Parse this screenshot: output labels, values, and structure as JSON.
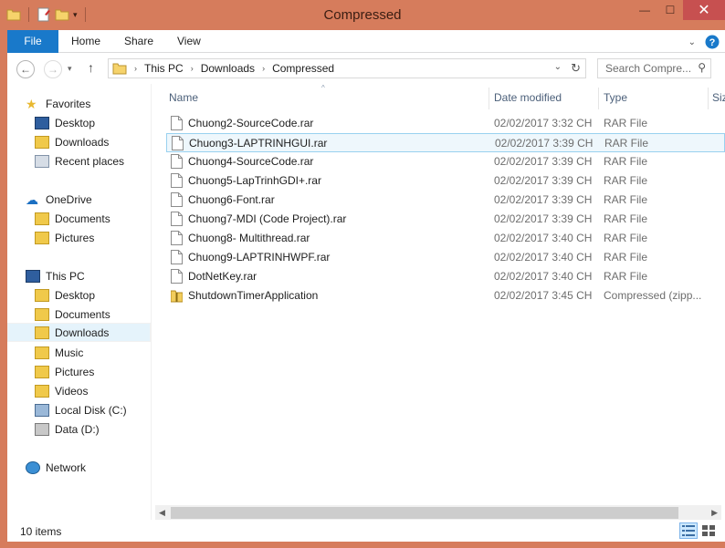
{
  "window": {
    "title": "Compressed"
  },
  "ribbon": {
    "tabs": [
      "File",
      "Home",
      "Share",
      "View"
    ]
  },
  "address": {
    "crumbs": [
      "This PC",
      "Downloads",
      "Compressed"
    ],
    "search_placeholder": "Search Compre..."
  },
  "nav": {
    "favorites": "Favorites",
    "desktop": "Desktop",
    "downloads": "Downloads",
    "recent": "Recent places",
    "onedrive": "OneDrive",
    "od_documents": "Documents",
    "od_pictures": "Pictures",
    "thispc": "This PC",
    "pc_desktop": "Desktop",
    "pc_documents": "Documents",
    "pc_downloads": "Downloads",
    "pc_music": "Music",
    "pc_pictures": "Pictures",
    "pc_videos": "Videos",
    "local_disk": "Local Disk (C:)",
    "data_disk": "Data (D:)",
    "network": "Network"
  },
  "columns": {
    "name": "Name",
    "date": "Date modified",
    "type": "Type",
    "size": "Siz"
  },
  "files": [
    {
      "name": "Chuong2-SourceCode.rar",
      "date": "02/02/2017 3:32 CH",
      "type": "RAR File",
      "icon": "file-icon"
    },
    {
      "name": "Chuong3-LAPTRINHGUI.rar",
      "date": "02/02/2017 3:39 CH",
      "type": "RAR File",
      "icon": "file-icon"
    },
    {
      "name": "Chuong4-SourceCode.rar",
      "date": "02/02/2017 3:39 CH",
      "type": "RAR File",
      "icon": "file-icon"
    },
    {
      "name": "Chuong5-LapTrinhGDI+.rar",
      "date": "02/02/2017 3:39 CH",
      "type": "RAR File",
      "icon": "file-icon"
    },
    {
      "name": "Chuong6-Font.rar",
      "date": "02/02/2017 3:39 CH",
      "type": "RAR File",
      "icon": "file-icon"
    },
    {
      "name": "Chuong7-MDI (Code Project).rar",
      "date": "02/02/2017 3:39 CH",
      "type": "RAR File",
      "icon": "file-icon"
    },
    {
      "name": "Chuong8- Multithread.rar",
      "date": "02/02/2017 3:40 CH",
      "type": "RAR File",
      "icon": "file-icon"
    },
    {
      "name": "Chuong9-LAPTRINHWPF.rar",
      "date": "02/02/2017 3:40 CH",
      "type": "RAR File",
      "icon": "file-icon"
    },
    {
      "name": "DotNetKey.rar",
      "date": "02/02/2017 3:40 CH",
      "type": "RAR File",
      "icon": "file-icon"
    },
    {
      "name": "ShutdownTimerApplication",
      "date": "02/02/2017 3:45 CH",
      "type": "Compressed (zipp...",
      "icon": "zip-folder-icon"
    }
  ],
  "status": {
    "count": "10 items"
  }
}
